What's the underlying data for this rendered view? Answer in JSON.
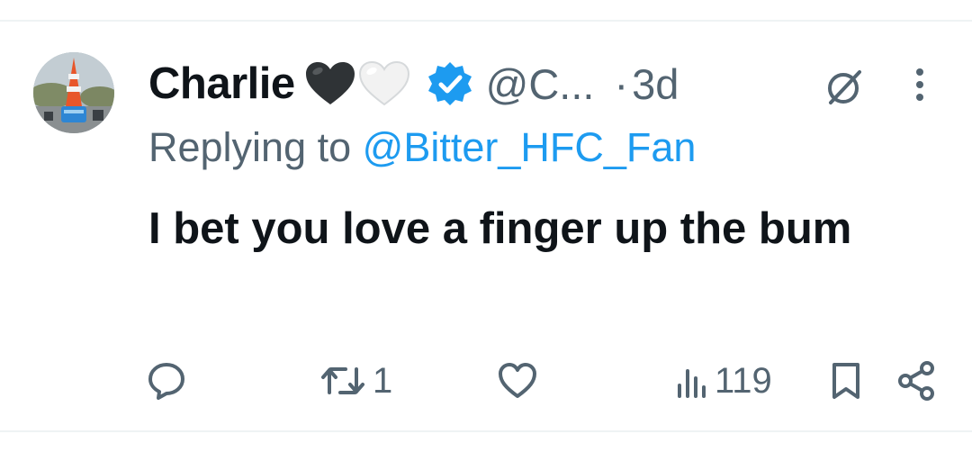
{
  "tweet": {
    "author_name": "Charlie",
    "emojis": [
      "black-heart",
      "white-heart"
    ],
    "handle": "@C...",
    "separator": "·",
    "time": "3d",
    "replying_prefix": "Replying to",
    "replying_to": "@Bitter_HFC_Fan",
    "text": "I bet you love a finger up the bum"
  },
  "actions": {
    "reply_icon": "reply-icon",
    "retweet_icon": "retweet-icon",
    "retweet_count": "1",
    "like_icon": "like-icon",
    "views_icon": "views-icon",
    "views_count": "119",
    "bookmark_icon": "bookmark-icon",
    "share_icon": "share-icon"
  },
  "colors": {
    "text": "#0f1419",
    "secondary": "#536471",
    "accent": "#1d9bf0",
    "divider": "#eff3f4"
  }
}
